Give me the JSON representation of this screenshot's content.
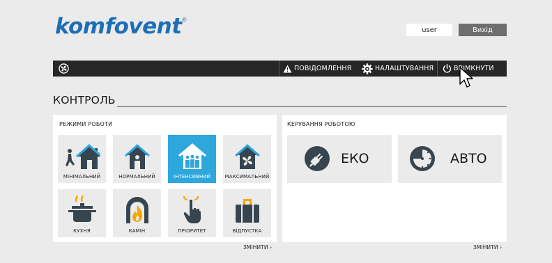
{
  "brand": {
    "name": "komfovent",
    "mark": "®"
  },
  "header": {
    "user": "user",
    "logout_label": "Вихід"
  },
  "navbar": {
    "fan_icon": "fan-icon",
    "notifications_label": "ПОВІДОМЛЕННЯ",
    "settings_label": "НАЛАШТУВАННЯ",
    "power_label": "ВВІМКНУТИ"
  },
  "page": {
    "title": "КОНТРОЛЬ"
  },
  "modes_panel": {
    "title": "РЕЖИМИ РОБОТИ",
    "change_label": "ЗМІНИТИ ›",
    "active_color": "#2ea7dd",
    "icon_color": "#36454f",
    "modes": [
      {
        "label": "МІНІМАЛЬНИЙ",
        "icon": "house-person-walking-icon",
        "active": false
      },
      {
        "label": "НОРМАЛЬНИЙ",
        "icon": "house-person-icon",
        "active": false
      },
      {
        "label": "ІНТЕНСИВНИЙ",
        "icon": "house-group-icon",
        "active": true
      },
      {
        "label": "МАКСИМАЛЬНИЙ",
        "icon": "house-fan-icon",
        "active": false
      },
      {
        "label": "КУХНЯ",
        "icon": "cooking-pot-icon",
        "active": false
      },
      {
        "label": "КАМІН",
        "icon": "fireplace-icon",
        "active": false
      },
      {
        "label": "ПРІОРИТЕТ",
        "icon": "pointing-hand-icon",
        "active": false
      },
      {
        "label": "ВІДПУСТКА",
        "icon": "suitcase-icon",
        "active": false
      }
    ]
  },
  "control_panel": {
    "title": "КЕРУВАННЯ РОБОТОЮ",
    "change_label": "ЗМІНИТИ ›",
    "eco_label": "ЕКО",
    "auto_label": "АВТО"
  }
}
